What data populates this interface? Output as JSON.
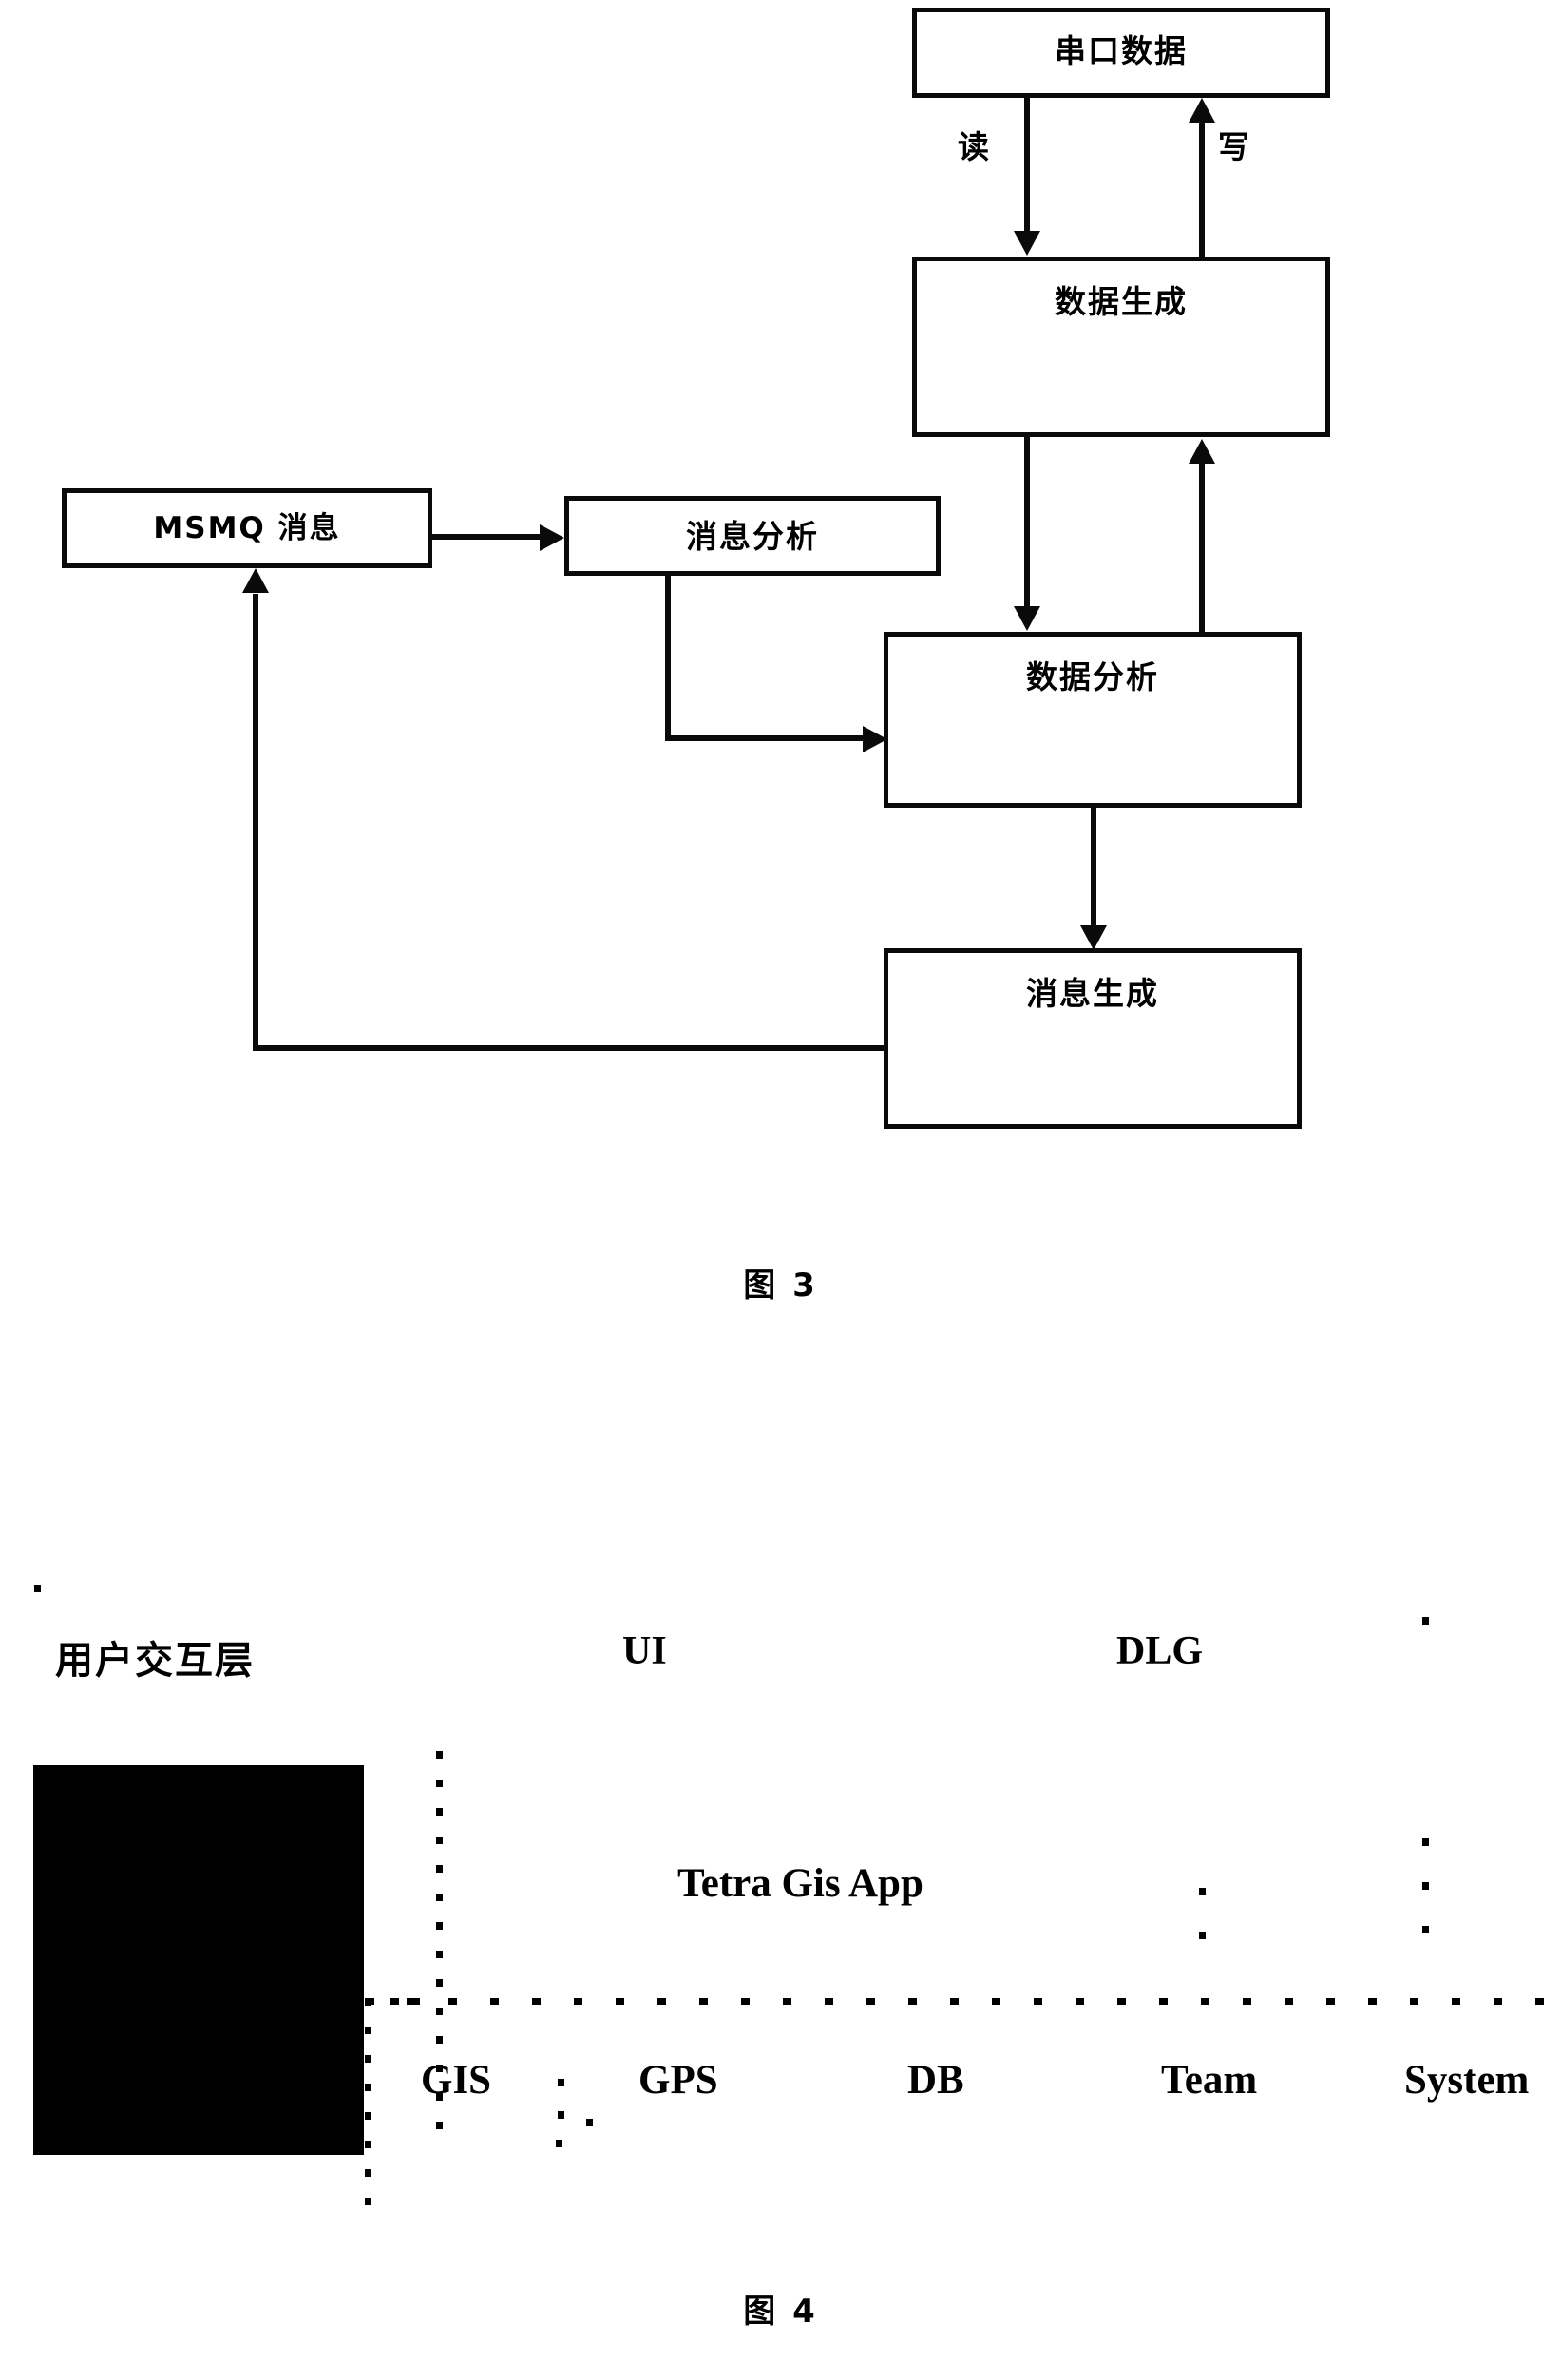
{
  "figure3": {
    "caption": "图 3",
    "nodes": [
      {
        "id": "serial_data",
        "label": "串口数据"
      },
      {
        "id": "data_generation",
        "label": "数据生成"
      },
      {
        "id": "msmq_message",
        "label": "MSMQ 消息"
      },
      {
        "id": "message_analysis",
        "label": "消息分析"
      },
      {
        "id": "data_analysis",
        "label": "数据分析"
      },
      {
        "id": "message_generation",
        "label": "消息生成"
      }
    ],
    "edge_labels": {
      "read": "读",
      "write": "写"
    }
  },
  "figure4": {
    "caption": "图 4",
    "layer_title": "用户交互层",
    "top_labels": [
      "UI",
      "DLG"
    ],
    "middle_label": "Tetra Gis App",
    "bottom_labels": [
      "GIS",
      "GPS",
      "DB",
      "Team",
      "System"
    ]
  }
}
